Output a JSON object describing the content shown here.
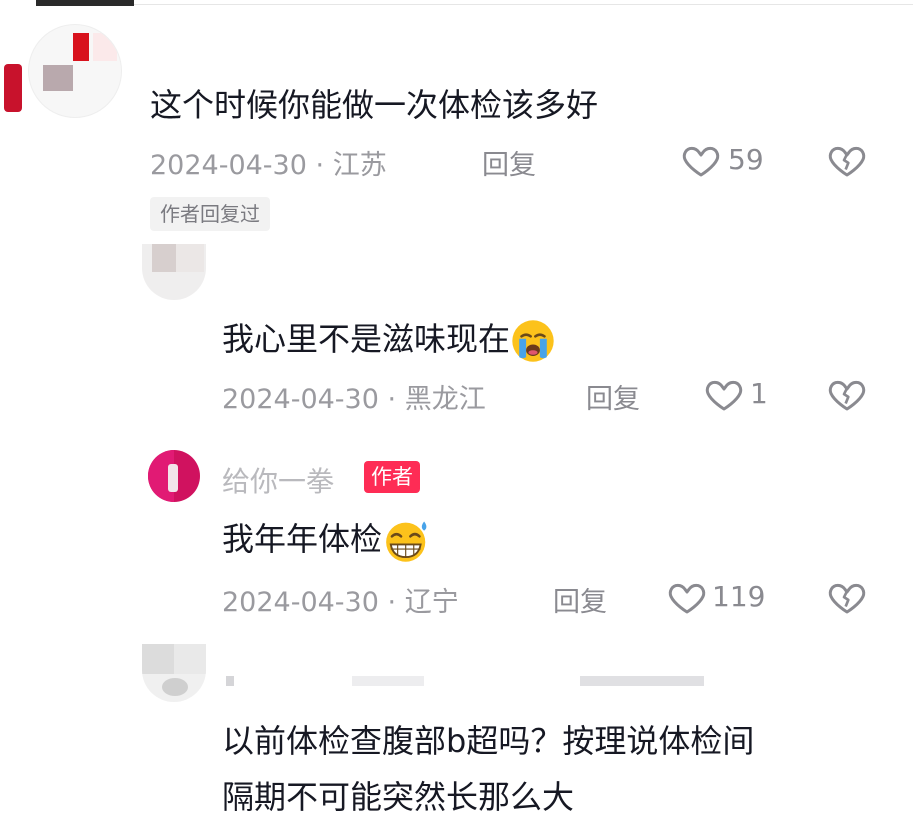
{
  "comments": [
    {
      "username": "",
      "text": "这个时候你能做一次体检该多好",
      "date": "2024-04-30",
      "location": "江苏",
      "reply_label": "回复",
      "likes": "59",
      "tag": "作者回复过"
    },
    {
      "username": "",
      "text": "我心里不是滋味现在",
      "emoji": "crying-face-icon",
      "date": "2024-04-30",
      "location": "黑龙江",
      "reply_label": "回复",
      "likes": "1"
    },
    {
      "username": "给你一拳",
      "badge": "作者",
      "text": "我年年体检",
      "emoji": "grinning-sweat-face-icon",
      "date": "2024-04-30",
      "location": "辽宁",
      "reply_label": "回复",
      "likes": "119"
    },
    {
      "username": "",
      "reply_to": "",
      "text_line1": "以前体检查腹部b超吗？按理说体检间",
      "text_line2": "隔期不可能突然长那么大"
    }
  ],
  "separator": "·",
  "colors": {
    "author_badge": "#fe2c55",
    "text_primary": "#161823",
    "text_secondary": "#9a9a9f"
  }
}
